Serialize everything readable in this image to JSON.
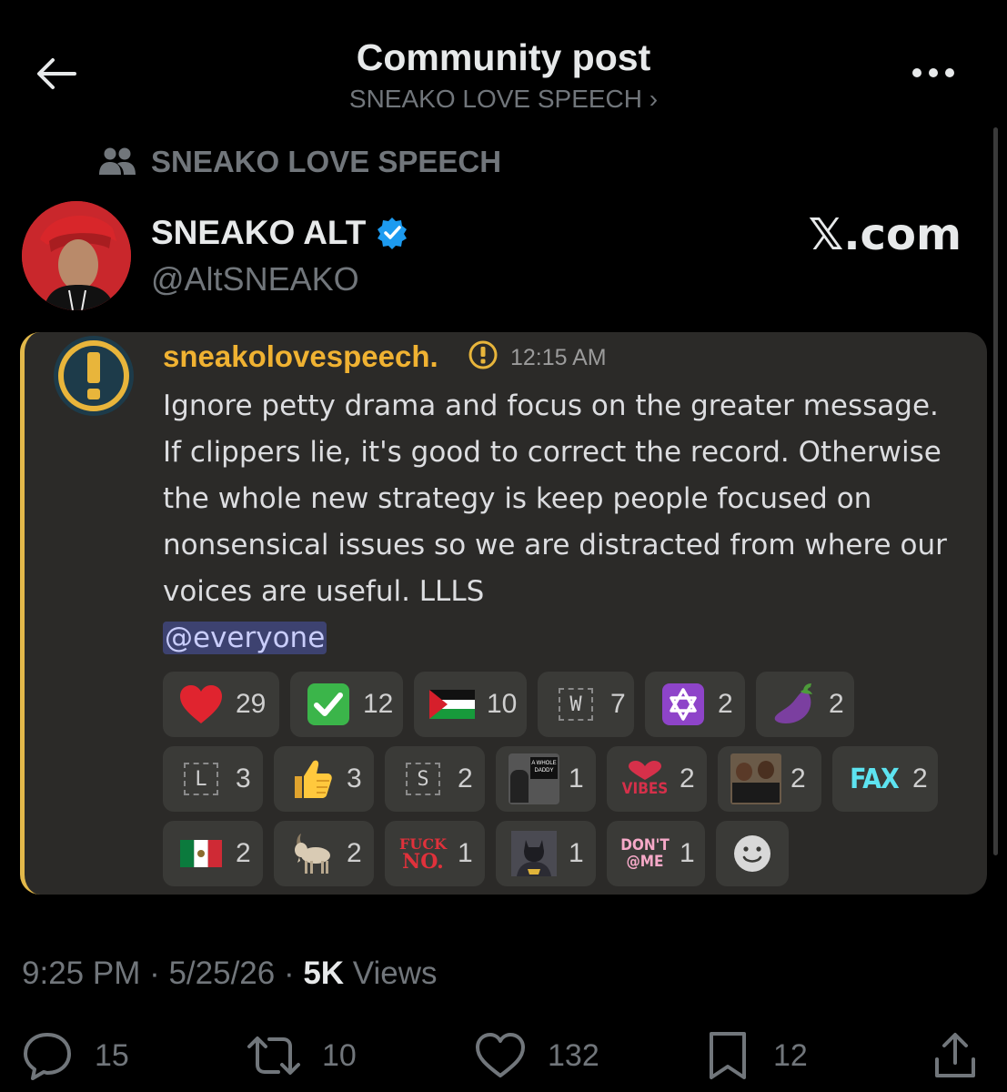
{
  "header": {
    "title": "Community post",
    "subtitle": "SNEAKO LOVE SPEECH ›"
  },
  "community": {
    "name": "SNEAKO LOVE SPEECH"
  },
  "author": {
    "name": "SNEAKO ALT",
    "handle": "@AltSNEAKO",
    "watermark": "𝕏.com"
  },
  "embed": {
    "username": "sneakolovespeech.",
    "time": "12:15 AM",
    "message": "Ignore petty drama and focus on the greater message. If clippers lie, it's good to correct the record. Otherwise the whole new strategy is keep people focused on nonsensical issues so we are distracted from where our voices are useful. LLLS",
    "mention": "@everyone",
    "reactions": [
      {
        "emoji": "red-heart",
        "count": "29"
      },
      {
        "emoji": "check-mark",
        "count": "12"
      },
      {
        "emoji": "palestine-flag",
        "count": "10"
      },
      {
        "emoji": "w-letter",
        "count": "7"
      },
      {
        "emoji": "star-of-david",
        "count": "2"
      },
      {
        "emoji": "eggplant",
        "count": "2"
      },
      {
        "emoji": "l-letter",
        "count": "3"
      },
      {
        "emoji": "thumbs-up",
        "count": "3"
      },
      {
        "emoji": "s-letter",
        "count": "2"
      },
      {
        "emoji": "a-whole-daddy-sticker",
        "count": "1"
      },
      {
        "emoji": "vibes-sticker",
        "count": "2"
      },
      {
        "emoji": "obama-medal-sticker",
        "count": "2"
      },
      {
        "emoji": "fax-sticker",
        "count": "2"
      },
      {
        "emoji": "mexico-flag",
        "count": "2"
      },
      {
        "emoji": "goat",
        "count": "2"
      },
      {
        "emoji": "fuck-no-sticker",
        "count": "1"
      },
      {
        "emoji": "batman-sticker",
        "count": "1"
      },
      {
        "emoji": "dont-at-me-sticker",
        "count": "1"
      },
      {
        "emoji": "add-reaction",
        "count": ""
      }
    ],
    "sticker_text": {
      "w": "W",
      "l": "L",
      "s": "S",
      "a_whole_daddy": "A WHOLE DADDY",
      "vibes": "VIBES",
      "fax": "FAX",
      "fuck": "FUCK",
      "no": "NO.",
      "dont": "DON'T",
      "at_me": "@ME"
    }
  },
  "meta": {
    "time": "9:25 PM · 5/25/26 · ",
    "views_count": "5K",
    "views_label": " Views"
  },
  "actions": {
    "replies": "15",
    "reposts": "10",
    "likes": "132",
    "bookmarks": "12"
  },
  "colors": {
    "background": "#000000",
    "embed_bg": "#2b2a28",
    "embed_accent": "#e2b84a",
    "discord_username": "#f0b232",
    "verified": "#1d9bf0",
    "muted": "#71767b"
  }
}
